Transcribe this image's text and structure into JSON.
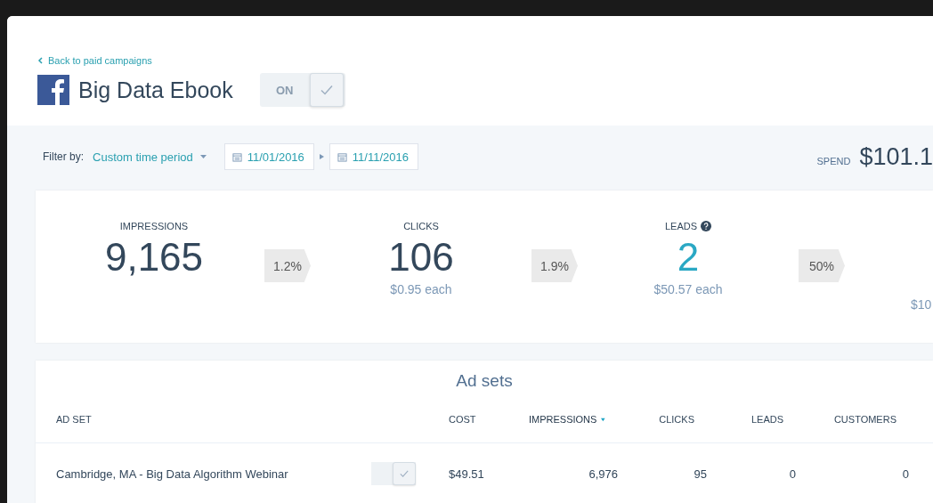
{
  "header": {
    "back_link": "Back to paid campaigns",
    "title": "Big Data Ebook",
    "toggle": {
      "label": "ON",
      "on": true
    }
  },
  "filter": {
    "label": "Filter by:",
    "period": "Custom time period",
    "start_date": "11/01/2016",
    "end_date": "11/11/2016"
  },
  "spend": {
    "label": "SPEND",
    "value": "$101.1"
  },
  "metrics": [
    {
      "kind": "metric",
      "label": "IMPRESSIONS",
      "value": "9,165",
      "highlight": false,
      "help": false
    },
    {
      "kind": "rate",
      "value": "1.2%"
    },
    {
      "kind": "metric",
      "label": "CLICKS",
      "value": "106",
      "sub": "$0.95 each",
      "highlight": false,
      "help": false
    },
    {
      "kind": "rate",
      "value": "1.9%"
    },
    {
      "kind": "metric",
      "label": "LEADS",
      "value": "2",
      "sub": "$50.57 each",
      "highlight": true,
      "help": true
    },
    {
      "kind": "rate",
      "value": "50%"
    },
    {
      "kind": "partial",
      "sub": "$10"
    }
  ],
  "ad_sets": {
    "title": "Ad sets",
    "columns": [
      {
        "label": "AD SET",
        "sorted": false
      },
      {
        "label": "COST",
        "sorted": false
      },
      {
        "label": "IMPRESSIONS",
        "sorted": true
      },
      {
        "label": "CLICKS",
        "sorted": false
      },
      {
        "label": "LEADS",
        "sorted": false
      },
      {
        "label": "CUSTOMERS",
        "sorted": false
      }
    ],
    "rows": [
      {
        "name": "Cambridge, MA - Big Data Algorithm Webinar",
        "on": true,
        "cost": "$49.51",
        "impressions": "6,976",
        "clicks": "95",
        "leads": "0",
        "customers": "0"
      }
    ]
  }
}
